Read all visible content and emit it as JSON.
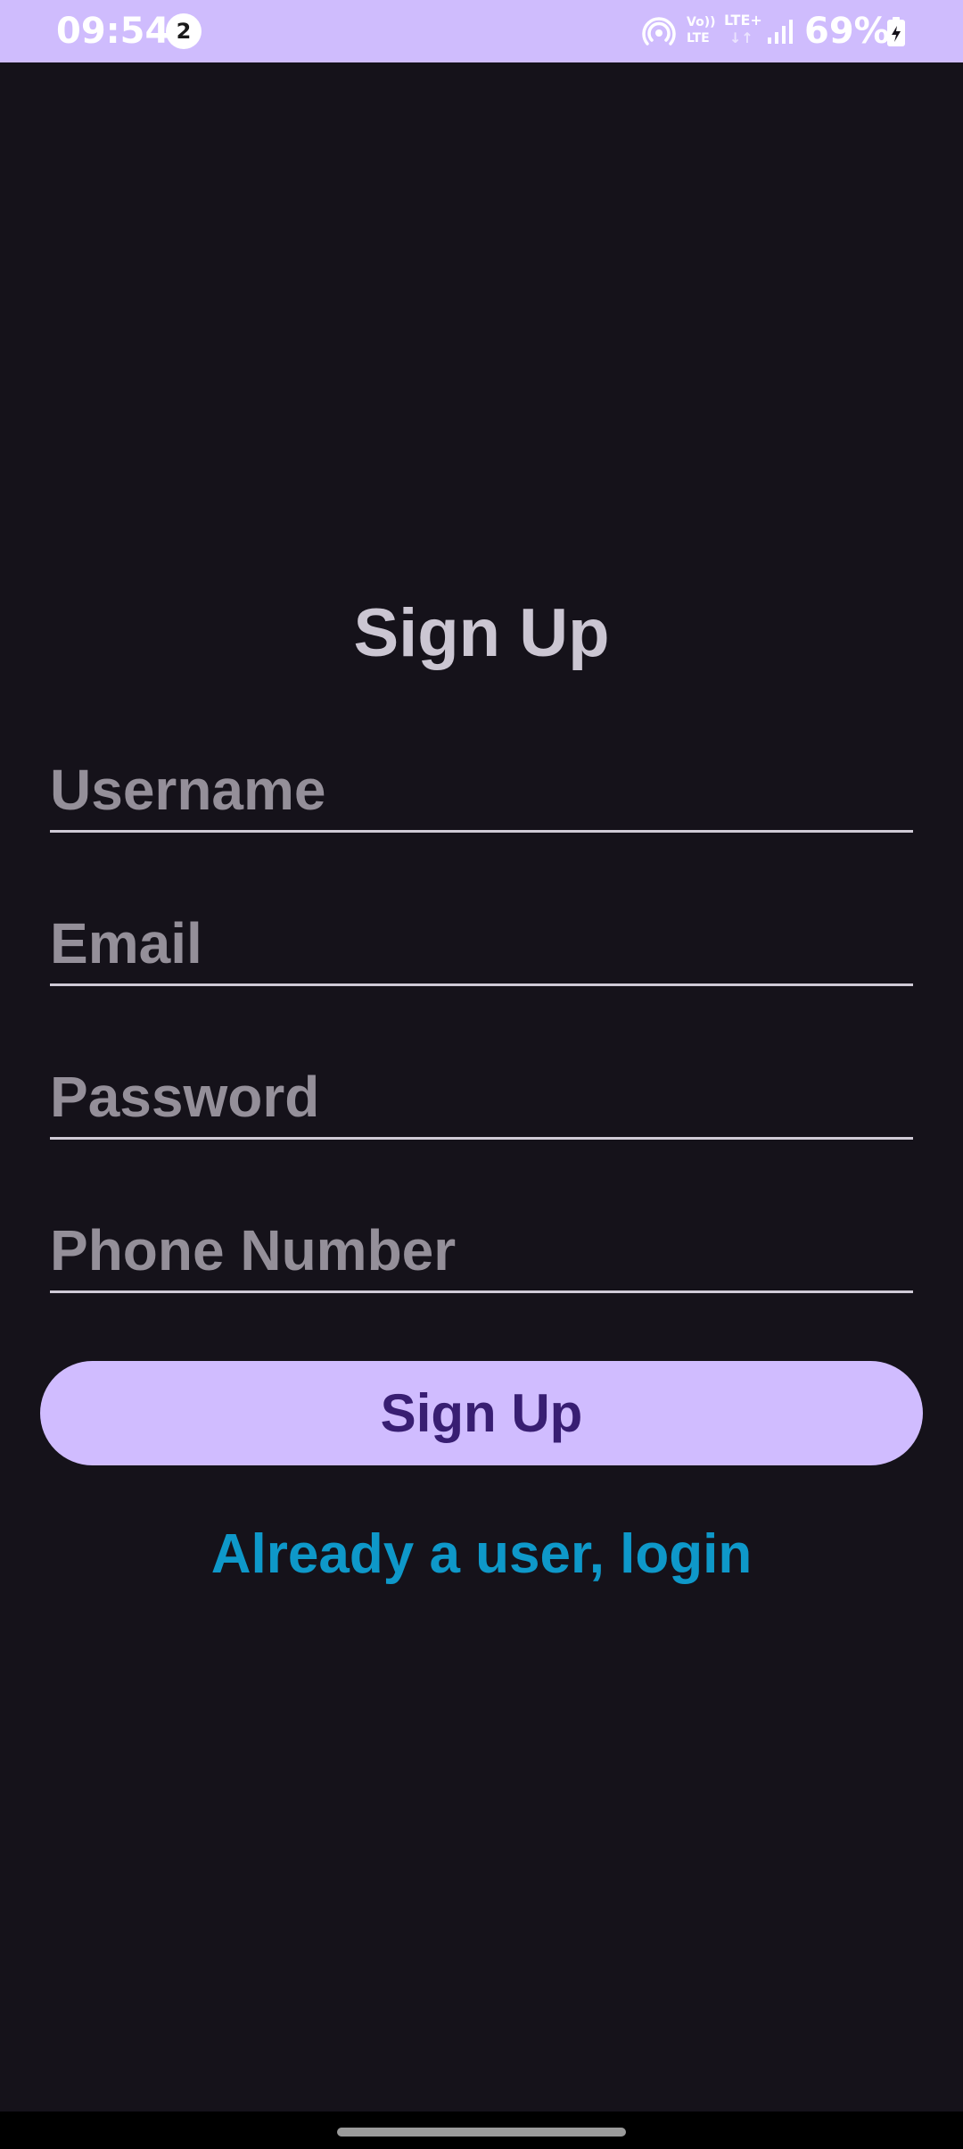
{
  "status_bar": {
    "time": "09:54",
    "notification_count": "2",
    "volte_line1": "Vo))",
    "volte_line2": "LTE",
    "network_type": "LTE+",
    "network_arrows": "↓↑",
    "battery_percent": "69%",
    "background_color": "#cfbcfd"
  },
  "signup_form": {
    "title": "Sign Up",
    "username_placeholder": "Username",
    "email_placeholder": "Email",
    "password_placeholder": "Password",
    "phone_placeholder": "Phone Number",
    "submit_label": "Sign Up",
    "login_link_label": "Already a user, login"
  },
  "theme": {
    "background": "#15121a",
    "accent": "#d0bcff",
    "button_text": "#381e72",
    "link": "#0e98c9"
  },
  "icons": {
    "hotspot": "hotspot-icon",
    "signal": "signal-strength-icon",
    "battery": "battery-charging-icon"
  }
}
